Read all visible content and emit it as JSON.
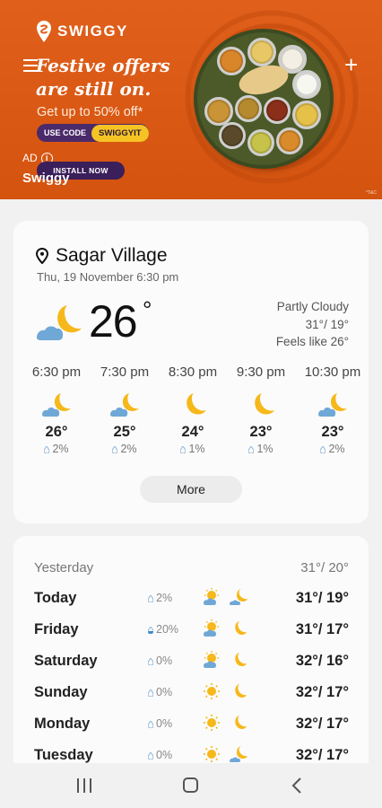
{
  "ad": {
    "brand": "SWIGGY",
    "headline_line1": "Festive offers",
    "headline_line2": "are still on.",
    "subtext": "Get up to 50% off*",
    "code_label": "USE CODE",
    "code_value": "SWIGGYIT",
    "ad_label": "AD",
    "install_label": "INSTALL NOW",
    "advertiser": "Swiggy",
    "tc": "*T&C"
  },
  "current": {
    "location": "Sagar Village",
    "datetime": "Thu, 19 November 6:30 pm",
    "temp": "26",
    "degree": "°",
    "condition": "Partly Cloudy",
    "hi_lo": "31°/ 19°",
    "feels_like": "Feels like 26°"
  },
  "hourly": [
    {
      "time": "6:30 pm",
      "icon": "moon-cloud-icon",
      "temp": "26°",
      "rain": "2%"
    },
    {
      "time": "7:30 pm",
      "icon": "moon-cloud-icon",
      "temp": "25°",
      "rain": "2%"
    },
    {
      "time": "8:30 pm",
      "icon": "moon-icon",
      "temp": "24°",
      "rain": "1%"
    },
    {
      "time": "9:30 pm",
      "icon": "moon-icon",
      "temp": "23°",
      "rain": "1%"
    },
    {
      "time": "10:30 pm",
      "icon": "moon-cloud-icon",
      "temp": "23°",
      "rain": "2%"
    }
  ],
  "more_label": "More",
  "daily": {
    "yesterday_label": "Yesterday",
    "yesterday_temps": "31°/ 20°",
    "days": [
      {
        "day": "Today",
        "rain": "2%",
        "day_icon": "sun-cloud-icon",
        "night_icon": "moon-cloud-icon",
        "temps": "31°/ 19°"
      },
      {
        "day": "Friday",
        "rain": "20%",
        "day_icon": "sun-cloud-icon",
        "night_icon": "moon-icon",
        "temps": "31°/ 17°"
      },
      {
        "day": "Saturday",
        "rain": "0%",
        "day_icon": "sun-cloud-icon",
        "night_icon": "moon-icon",
        "temps": "32°/ 16°"
      },
      {
        "day": "Sunday",
        "rain": "0%",
        "day_icon": "sun-icon",
        "night_icon": "moon-icon",
        "temps": "32°/ 17°"
      },
      {
        "day": "Monday",
        "rain": "0%",
        "day_icon": "sun-icon",
        "night_icon": "moon-icon",
        "temps": "32°/ 17°"
      },
      {
        "day": "Tuesday",
        "rain": "0%",
        "day_icon": "sun-icon",
        "night_icon": "moon-cloud-icon",
        "temps": "32°/ 17°"
      }
    ]
  },
  "colors": {
    "ad_bg": "#d9591a",
    "sun": "#f6b81a",
    "cloud": "#6fa8d6",
    "card_bg": "#fbfbfb"
  }
}
